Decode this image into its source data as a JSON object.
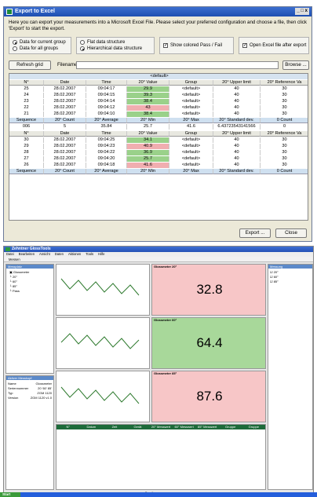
{
  "dialog": {
    "title": "Export to Excel",
    "window_buttons": "_ □ x",
    "intro": "Here you can export your measurements into a Microsoft Excel File. Please select your preferred configuration and choose a file, then click 'Export' to start the export.",
    "data_scope": {
      "option1": "Data for current group",
      "option2": "Data for all groups"
    },
    "structure": {
      "option1": "Flat data structure",
      "option2": "Hierarchical data structure"
    },
    "show_colored": "Show colored Pass / Fail",
    "open_excel": "Open Excel file after export",
    "refresh_label": "Refresh grid",
    "filename_label": "Filename:",
    "browse_label": "Browse ...",
    "group_label": "<default>",
    "export_label": "Export ...",
    "close_label": "Close",
    "grid": {
      "meas_headers": [
        "N°",
        "Date",
        "Time",
        "20° Value",
        "Group",
        "20° Upper limit",
        "20° Reference Va"
      ],
      "block1": [
        [
          "25",
          "28.02.2007",
          "09:04:17",
          "29.9",
          "<default>",
          "40",
          "30",
          "green"
        ],
        [
          "24",
          "28.02.2007",
          "09:04:15",
          "39.3",
          "<default>",
          "40",
          "30",
          "green"
        ],
        [
          "23",
          "28.02.2007",
          "09:04:14",
          "38.4",
          "<default>",
          "40",
          "30",
          "green"
        ],
        [
          "22",
          "28.02.2007",
          "09:04:12",
          "43",
          "<default>",
          "40",
          "30",
          "red"
        ],
        [
          "21",
          "28.02.2007",
          "09:04:10",
          "38.4",
          "<default>",
          "40",
          "30",
          "green"
        ]
      ],
      "seq_headers": [
        "Sequence",
        "20° Count",
        "20° Average",
        "20° Min",
        "20° Max",
        "20° Standard dev.",
        "0 Count"
      ],
      "seq_row": [
        "006",
        "5",
        "35.84",
        "25.7",
        "41.6",
        "6.43723543141566",
        "0"
      ],
      "block2": [
        [
          "30",
          "28.02.2007",
          "09:04:25",
          "34.1",
          "<default>",
          "40",
          "30",
          "green"
        ],
        [
          "29",
          "28.02.2007",
          "09:04:23",
          "40.9",
          "<default>",
          "40",
          "30",
          "red"
        ],
        [
          "28",
          "28.02.2007",
          "09:04:22",
          "36.9",
          "<default>",
          "40",
          "30",
          "green"
        ],
        [
          "27",
          "28.02.2007",
          "09:04:20",
          "25.7",
          "<default>",
          "40",
          "30",
          "green"
        ],
        [
          "26",
          "28.02.2007",
          "09:04:18",
          "41.6",
          "<default>",
          "40",
          "30",
          "red"
        ]
      ],
      "seq_footer": [
        "Sequence",
        "20° Count",
        "20° Average",
        "20° Min",
        "20° Max",
        "20° Standard dev.",
        "0 Count"
      ]
    }
  },
  "app": {
    "title": "Zehntner GlossTools",
    "menu": [
      "Datei",
      "Bearbeiten",
      "Ansicht",
      "Daten",
      "Aktionen",
      "Tools",
      "Hilfe"
    ],
    "toolbar": "Messen",
    "left_panel_title": "Messplatz",
    "tree": [
      "Glossmeter",
      "20°",
      "60°",
      "85°",
      "Pass"
    ],
    "info_title": "Aktiver Messkopf",
    "info": [
      [
        "Name",
        "Glossmeter"
      ],
      [
        "Seriennummer",
        "20 '60' 85'"
      ],
      [
        "Typ",
        "ZGM 1120"
      ],
      [
        "Version",
        "ZGM 1120 v1.0"
      ]
    ],
    "measurements": [
      {
        "title": "Glossmeter 20°",
        "value": "32.8",
        "color": "#f7c6c7"
      },
      {
        "title": "Glossmeter 60°",
        "value": "64.4",
        "color": "#a8d89a"
      },
      {
        "title": "Glossmeter 85°",
        "value": "87.6",
        "color": "#f7c6c7"
      }
    ],
    "right_panel_title": "Messung",
    "right_items": [
      "20°",
      "60°",
      "85°"
    ],
    "table_headers": [
      "N°",
      "Datum",
      "Zeit",
      "Gerät",
      "20° Messwert",
      "60° Messwert",
      "85° Messwert",
      "Gruppe",
      "Gruppe"
    ],
    "statusbar": "Bereit",
    "taskbar_start": "Start"
  }
}
